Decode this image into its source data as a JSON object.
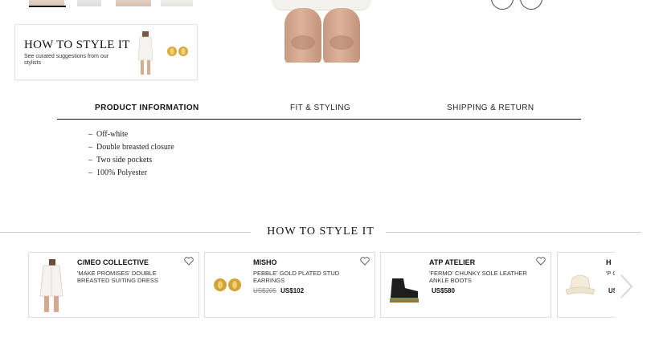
{
  "style_card": {
    "title": "HOW TO STYLE IT",
    "subtitle": "See curated suggestions from our stylists"
  },
  "tabs": [
    {
      "label": "PRODUCT INFORMATION",
      "active": true
    },
    {
      "label": "FIT & STYLING",
      "active": false
    },
    {
      "label": "SHIPPING & RETURN",
      "active": false
    }
  ],
  "details": [
    "Off-white",
    "Double breasted closure",
    "Two side pockets",
    "100% Polyester"
  ],
  "section_title": "HOW TO STYLE IT",
  "products": [
    {
      "brand": "C/MEO COLLECTIVE",
      "name": "'MAKE PROMISES' DOUBLE BREASTED SUITING DRESS",
      "old_price": "",
      "price": "",
      "icon": "dress-image"
    },
    {
      "brand": "MISHO",
      "name": "PEBBLE' GOLD PLATED STUD EARRINGS",
      "old_price": "US$205",
      "price": "US$102",
      "icon": "earrings-image"
    },
    {
      "brand": "ATP ATELIER",
      "name": "'FERMO' CHUNKY SOLE LEATHER ANKLE BOOTS",
      "old_price": "",
      "price": "US$580",
      "icon": "boots-image"
    },
    {
      "brand": "H",
      "name": "'P C",
      "old_price": "",
      "price": "US",
      "icon": "bucket-hat-image"
    }
  ],
  "colors": {
    "accent": "#111111",
    "border": "#dcdcdc",
    "gold": "#c9a03a"
  }
}
